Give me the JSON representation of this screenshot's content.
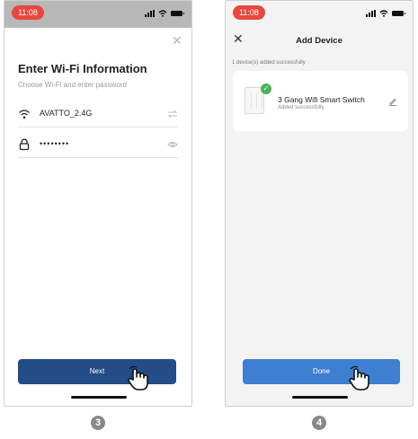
{
  "left": {
    "time": "11:08",
    "title": "Enter Wi-Fi Information",
    "subtitle": "Choose Wi-Fi and enter password",
    "wifi_name": "AVATTO_2.4G",
    "password_mask": "••••••••",
    "next_label": "Next",
    "step": "3",
    "icons": [
      "wifi-icon",
      "lock-icon",
      "switch-network-icon",
      "eye-icon",
      "close-icon",
      "tap-hand-icon"
    ]
  },
  "right": {
    "time": "11:08",
    "header_title": "Add Device",
    "count_text": "1 device(s) added successfully",
    "device_name": "3 Gang Wifi Smart Switch",
    "device_status": "Added successfully",
    "done_label": "Done",
    "step": "4",
    "icons": [
      "close-icon",
      "check-icon",
      "edit-icon",
      "tap-hand-icon"
    ]
  },
  "colors": {
    "time_pill": "#e8473f",
    "next_button": "#244c86",
    "done_button": "#3e7fd1",
    "success_check": "#4cb35a"
  }
}
